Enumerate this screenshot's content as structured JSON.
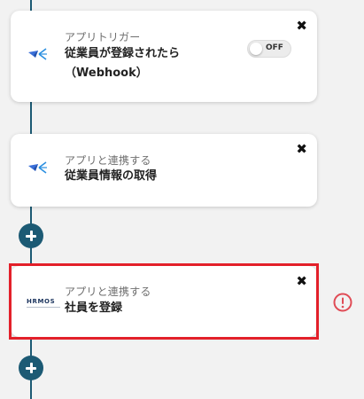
{
  "steps": [
    {
      "type_label": "アプリトリガー",
      "title_line1": "従業員が登録されたら",
      "title_line2": "（Webhook）",
      "toggle_label": "OFF",
      "icon": "smarthr-paper-plane-icon"
    },
    {
      "type_label": "アプリと連携する",
      "title": "従業員情報の取得",
      "icon": "smarthr-paper-plane-icon"
    },
    {
      "type_label": "アプリと連携する",
      "title": "社員を登録",
      "icon": "hrmos-logo",
      "logo_text": "HRMOS",
      "status": "error"
    }
  ],
  "close_glyph": "✖",
  "colors": {
    "connector": "#1c5a74",
    "highlight": "#e3202a",
    "error": "#e04b55"
  }
}
